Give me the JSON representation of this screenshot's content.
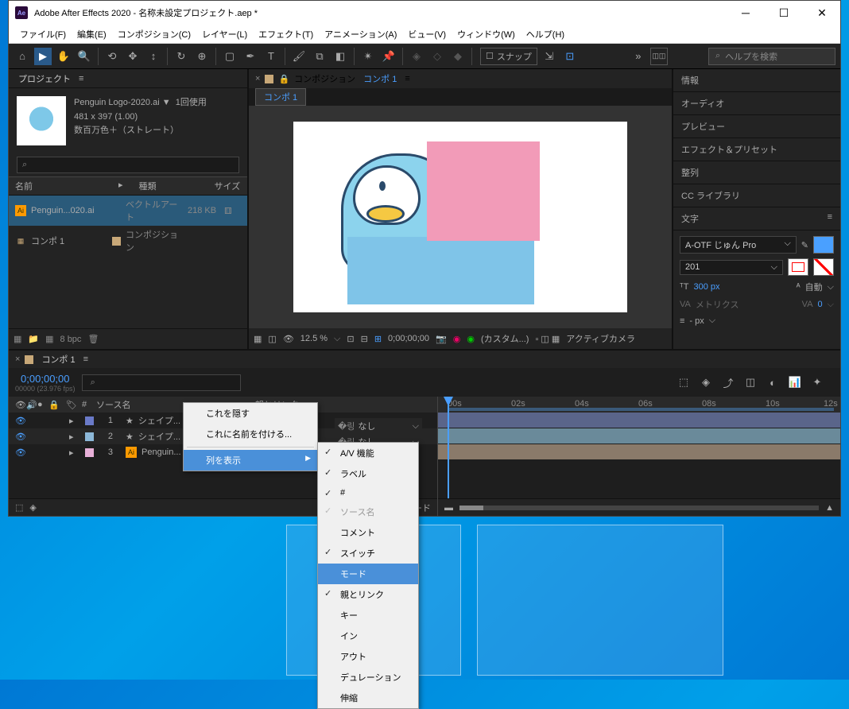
{
  "title": "Adobe After Effects 2020 - 名称未設定プロジェクト.aep *",
  "menu": [
    "ファイル(F)",
    "編集(E)",
    "コンポジション(C)",
    "レイヤー(L)",
    "エフェクト(T)",
    "アニメーション(A)",
    "ビュー(V)",
    "ウィンドウ(W)",
    "ヘルプ(H)"
  ],
  "toolbar": {
    "snap": "スナップ",
    "search_placeholder": "ヘルプを検索"
  },
  "project": {
    "title": "プロジェクト",
    "filename": "Penguin Logo-2020.ai ▼",
    "usage": "1回使用",
    "dims": "481 x 397 (1.00)",
    "colors": "数百万色＋（ストレート）",
    "search": "",
    "cols": {
      "name": "名前",
      "type": "種類",
      "size": "サイズ"
    },
    "rows": [
      {
        "icon": "Ai",
        "name": "Penguin...020.ai",
        "type": "ベクトルアート",
        "size": "218 KB",
        "sel": true,
        "color": "#e8b0d8"
      },
      {
        "icon": "▦",
        "name": "コンポ 1",
        "type": "コンポジション",
        "size": "",
        "sel": false,
        "color": "#c8a878"
      }
    ],
    "bpc": "8 bpc"
  },
  "comp": {
    "prefix": "コンポジション",
    "name": "コンポ 1",
    "tab": "コンポ 1"
  },
  "viewer_footer": {
    "zoom": "12.5 %",
    "time": "0;00;00;00",
    "custom": "(カスタム...)",
    "camera": "アクティブカメラ"
  },
  "right_panels": [
    "情報",
    "オーディオ",
    "プレビュー",
    "エフェクト＆プリセット",
    "整列",
    "CC ライブラリ"
  ],
  "char": {
    "title": "文字",
    "font": "A-OTF じゅん Pro",
    "weight": "201",
    "size_label": "300 px",
    "auto": "自動",
    "metrics": "メトリクス",
    "zero": "0",
    "px": "- px"
  },
  "timeline": {
    "tab": "コンポ 1",
    "timecode": "0;00;00;00",
    "fps": "00000 (23.976 fps)",
    "col_source": "ソース名",
    "col_parent": "親とリンク",
    "parent_none": "なし",
    "ticks": [
      "00s",
      "02s",
      "04s",
      "06s",
      "08s",
      "10s",
      "12s"
    ],
    "layers": [
      {
        "n": "1",
        "name": "シェイプ...",
        "color": "#6a7ac8",
        "star": true
      },
      {
        "n": "2",
        "name": "シェイプ...",
        "color": "#8cb8d8",
        "star": true
      },
      {
        "n": "3",
        "name": "Penguin...",
        "color": "#e8b0d8",
        "star": false,
        "ai": true
      }
    ],
    "footer_switch": "スイッチ / モード"
  },
  "ctx1": {
    "hide": "これを隠す",
    "rename": "これに名前を付ける...",
    "columns": "列を表示"
  },
  "ctx2": [
    "A/V 機能",
    "ラベル",
    "#",
    "ソース名",
    "コメント",
    "スイッチ",
    "モード",
    "親とリンク",
    "キー",
    "イン",
    "アウト",
    "デュレーション",
    "伸縮"
  ]
}
